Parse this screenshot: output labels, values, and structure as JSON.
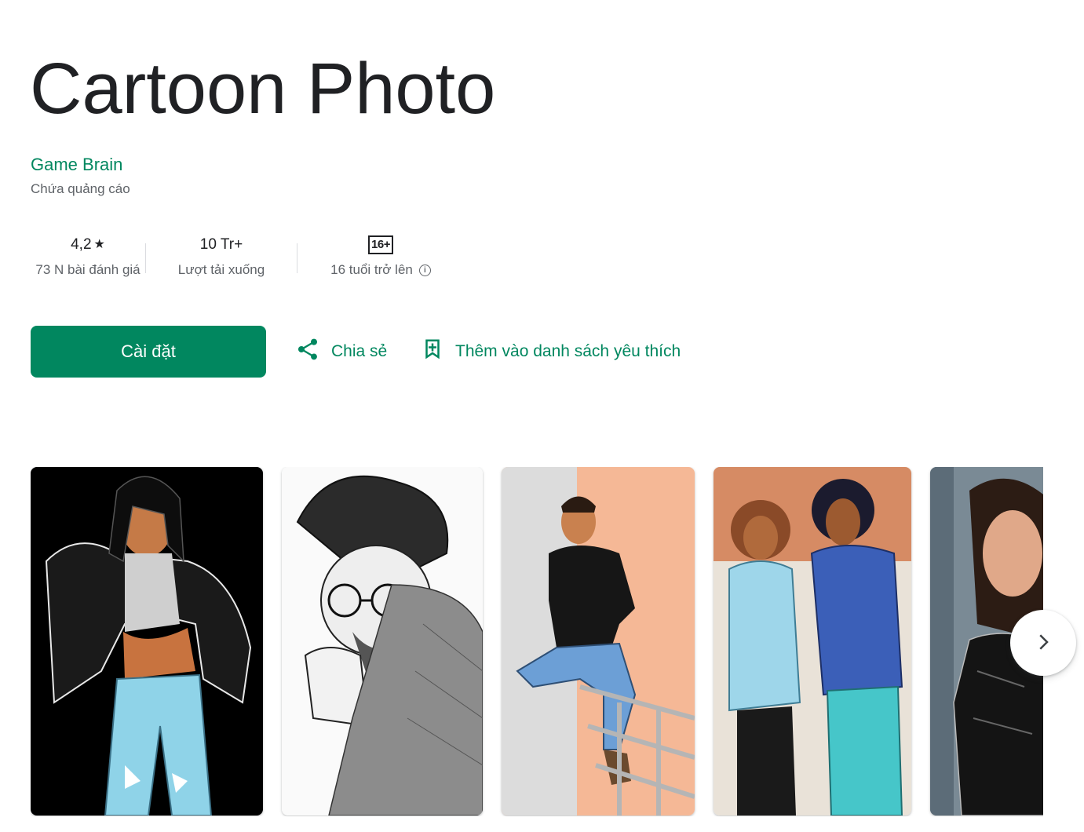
{
  "app": {
    "title": "Cartoon Photo",
    "developer": "Game Brain",
    "ads_note": "Chứa quảng cáo"
  },
  "stats": {
    "rating_value": "4,2",
    "rating_star": "★",
    "reviews": "73 N bài đánh giá",
    "downloads_value": "10 Tr+",
    "downloads_label": "Lượt tải xuống",
    "age_badge": "16+",
    "age_label": "16 tuổi trở lên"
  },
  "actions": {
    "install_label": "Cài đặt",
    "share_label": "Chia sẻ",
    "wishlist_label": "Thêm vào danh sách yêu thích"
  },
  "colors": {
    "accent": "#01875f",
    "title": "#202124",
    "muted": "#5f6368"
  },
  "icons": {
    "share": "share-icon",
    "wishlist": "bookmark-add-icon",
    "info": "info-icon",
    "next": "chevron-right-icon"
  }
}
